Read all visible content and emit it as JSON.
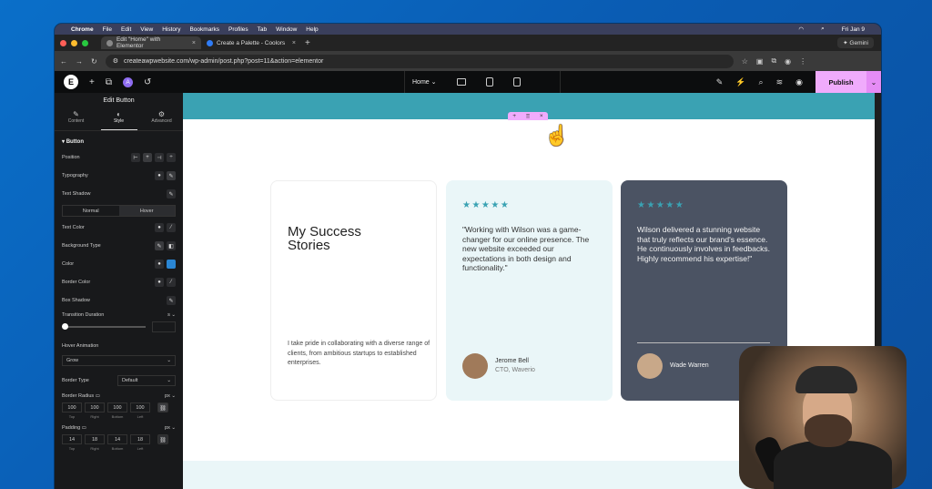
{
  "menubar": {
    "app": "Chrome",
    "items": [
      "File",
      "Edit",
      "View",
      "History",
      "Bookmarks",
      "Profiles",
      "Tab",
      "Window",
      "Help"
    ],
    "clock": "Fri Jan 9"
  },
  "tabs": [
    {
      "title": "Edit \"Home\" with Elementor"
    },
    {
      "title": "Create a Palette - Coolors"
    }
  ],
  "browser": {
    "gemini": "Gemini",
    "url": "createawpwebsite.com/wp-admin/post.php?post=11&action=elementor"
  },
  "editor": {
    "logo": "E",
    "avatar": "A",
    "page": "Home",
    "publish": "Publish"
  },
  "panel": {
    "title": "Edit Button",
    "tabs": [
      "Content",
      "Style",
      "Advanced"
    ],
    "section": "Button",
    "position": "Position",
    "typography": "Typography",
    "text_shadow": "Text Shadow",
    "seg_normal": "Normal",
    "seg_hover": "Hover",
    "text_color": "Text Color",
    "background_type": "Background Type",
    "color": "Color",
    "border_color": "Border Color",
    "box_shadow": "Box Shadow",
    "transition_duration": "Transition Duration",
    "hover_animation": "Hover Animation",
    "hover_animation_value": "Grow",
    "border_type": "Border Type",
    "border_type_value": "Default",
    "border_radius": "Border Radius",
    "radius_unit": "px",
    "radius_values": [
      "100",
      "100",
      "100",
      "100"
    ],
    "sides": [
      "Top",
      "Right",
      "Bottom",
      "Left"
    ],
    "padding": "Padding",
    "padding_unit": "px",
    "padding_values": [
      "14",
      "18",
      "14",
      "18"
    ]
  },
  "canvas": {
    "intro": {
      "heading": "My Success Stories",
      "text": "I take pride in collaborating with a diverse range of clients, from ambitious startups to established enterprises."
    },
    "stars": "★★★★★",
    "testimonials": [
      {
        "quote": "\"Working with Wilson was a game-changer for our online presence. The new website exceeded our expectations in both design and functionality.\"",
        "name": "Jerome Bell",
        "role": "CTO, Waverio"
      },
      {
        "quote": "Wilson delivered a stunning website that truly reflects our brand's essence. He continuously involves in feedbacks. Highly recommend his expertise!\"",
        "name": "Wade Warren",
        "role": ""
      }
    ]
  },
  "colors": {
    "accent": "#f0abfc",
    "teal": "#3aa2b3",
    "dark_card": "#4b5363",
    "light_card": "#eaf6f8"
  }
}
